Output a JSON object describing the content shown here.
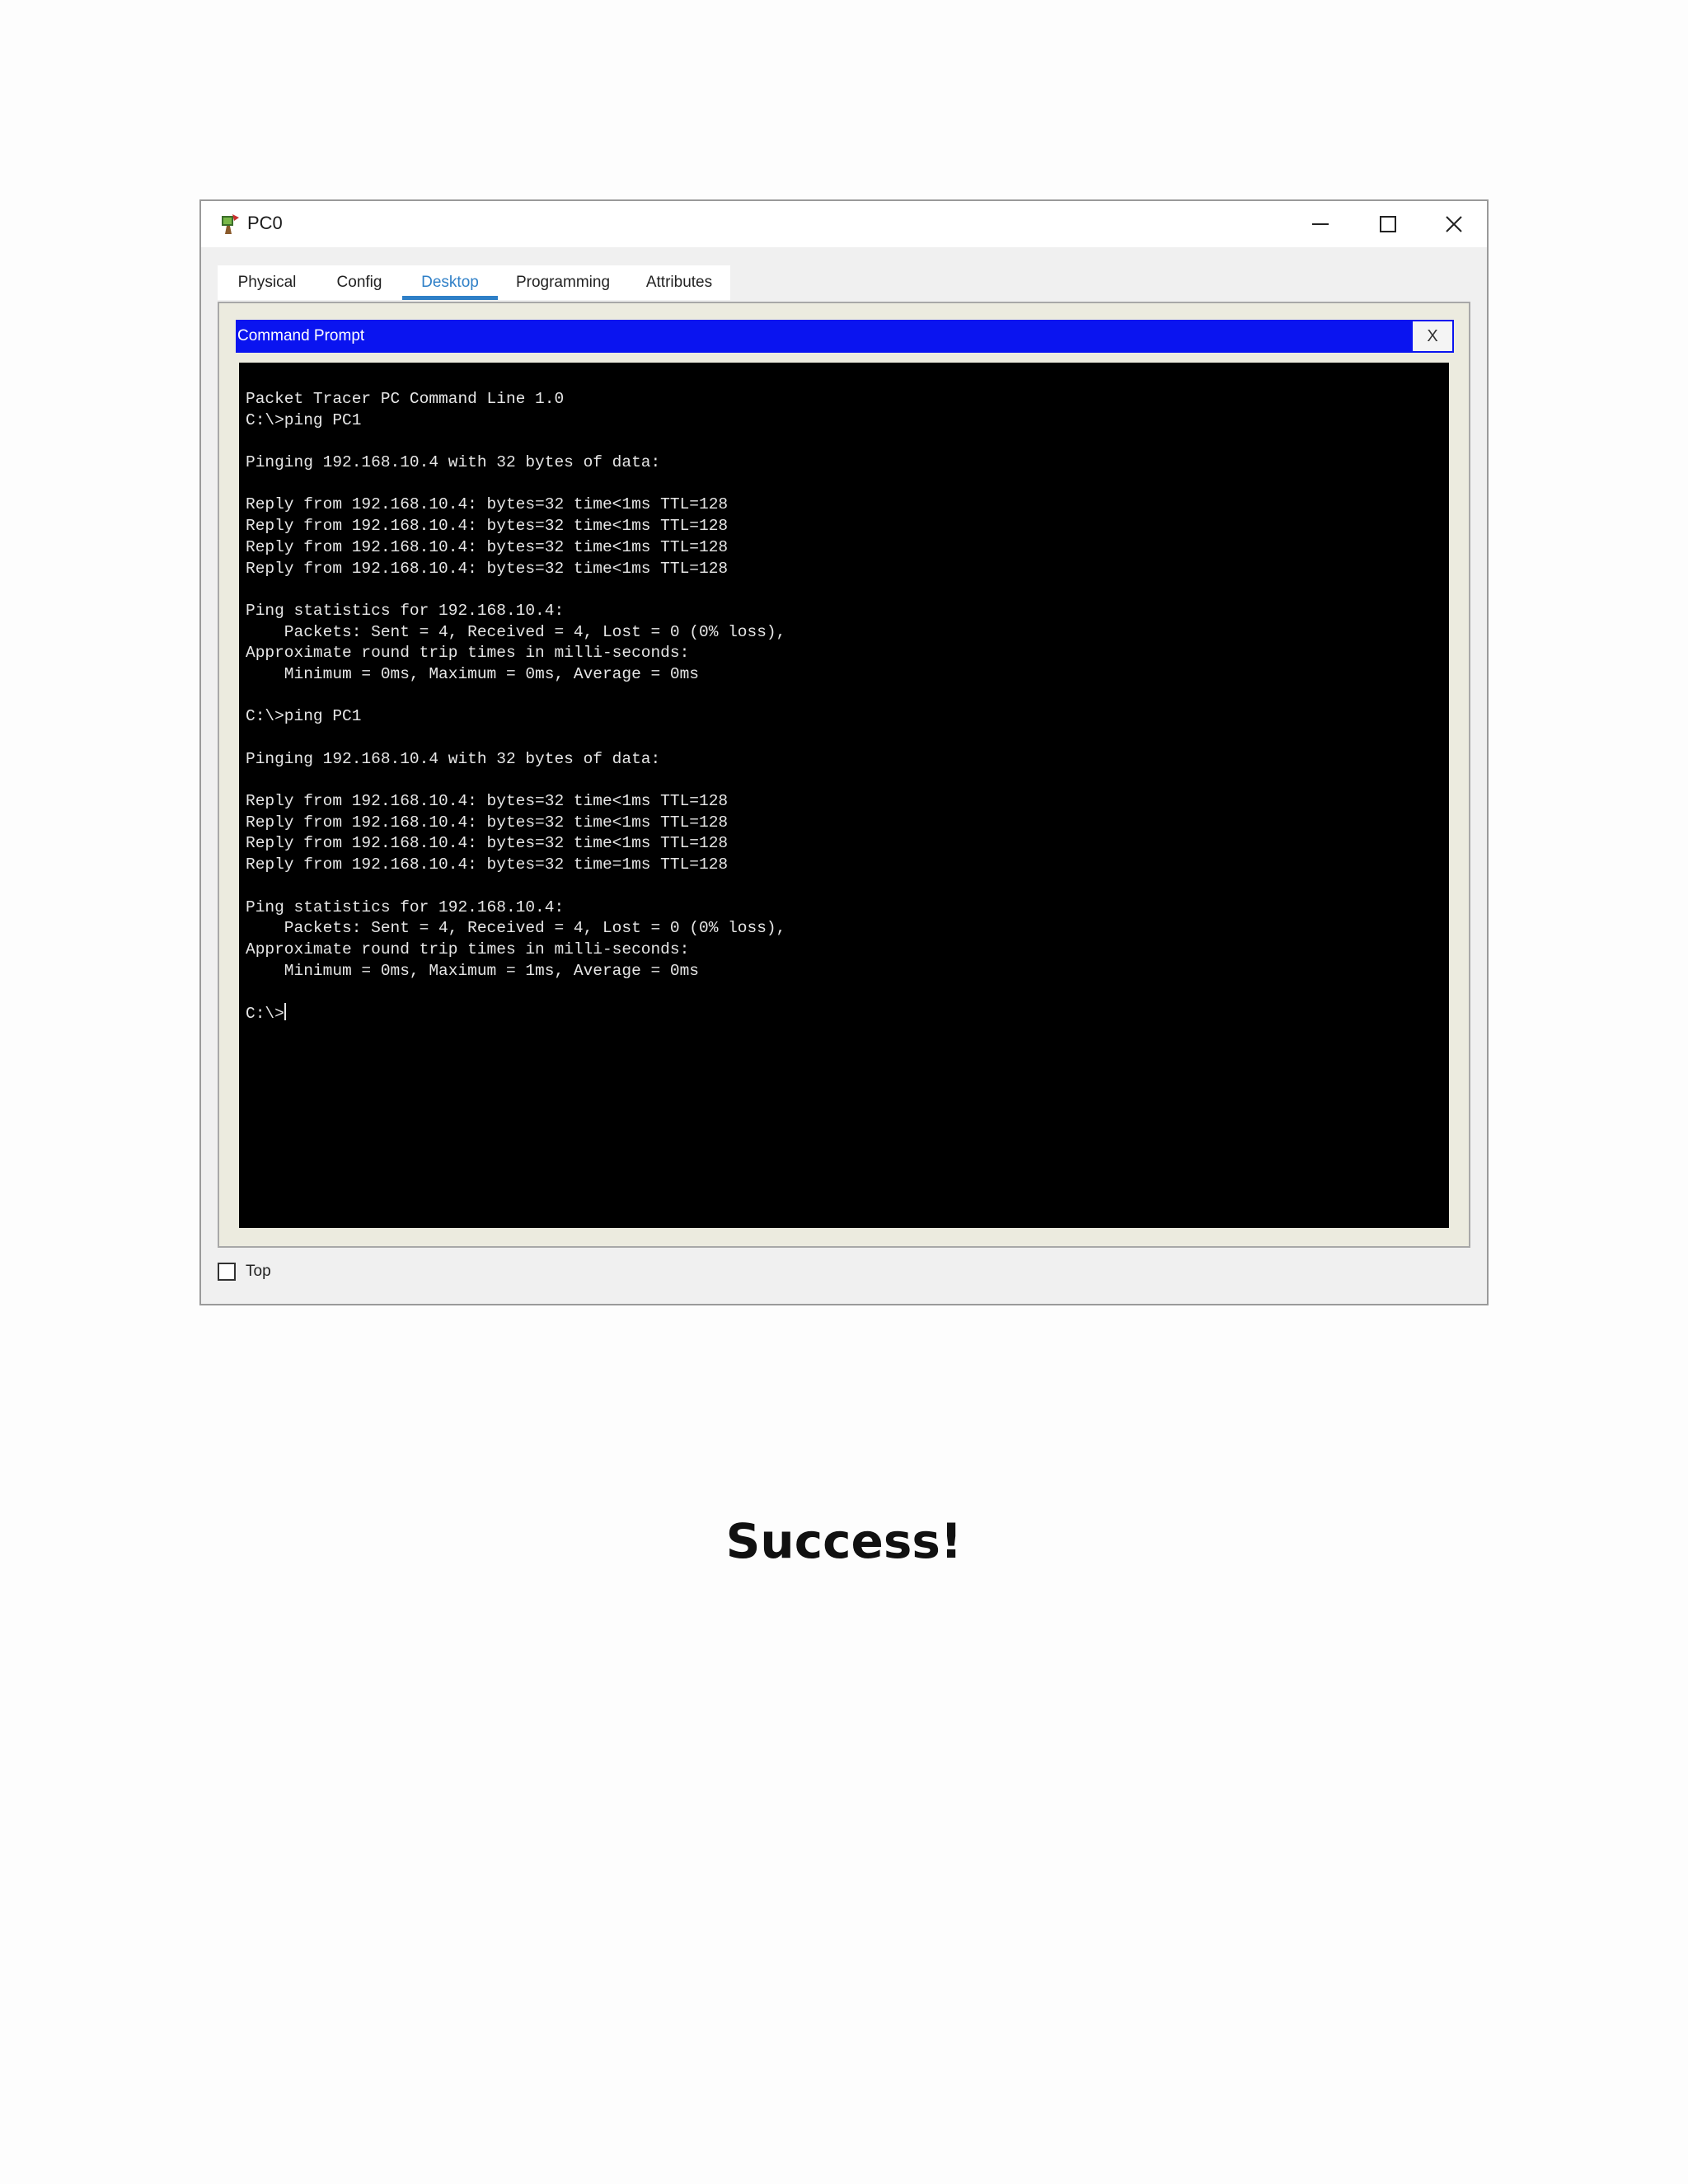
{
  "window": {
    "title": "PC0",
    "icon": "packet-tracer-pc-icon",
    "controls": [
      "minimize-icon",
      "maximize-icon",
      "close-icon"
    ]
  },
  "tabs": [
    {
      "label": "Physical",
      "active": false
    },
    {
      "label": "Config",
      "active": false
    },
    {
      "label": "Desktop",
      "active": true
    },
    {
      "label": "Programming",
      "active": false
    },
    {
      "label": "Attributes",
      "active": false
    }
  ],
  "command_prompt": {
    "title": "Command Prompt",
    "close_label": "X",
    "lines": [
      "Packet Tracer PC Command Line 1.0",
      "C:\\>ping PC1",
      "",
      "Pinging 192.168.10.4 with 32 bytes of data:",
      "",
      "Reply from 192.168.10.4: bytes=32 time<1ms TTL=128",
      "Reply from 192.168.10.4: bytes=32 time<1ms TTL=128",
      "Reply from 192.168.10.4: bytes=32 time<1ms TTL=128",
      "Reply from 192.168.10.4: bytes=32 time<1ms TTL=128",
      "",
      "Ping statistics for 192.168.10.4:",
      "    Packets: Sent = 4, Received = 4, Lost = 0 (0% loss),",
      "Approximate round trip times in milli-seconds:",
      "    Minimum = 0ms, Maximum = 0ms, Average = 0ms",
      "",
      "C:\\>ping PC1",
      "",
      "Pinging 192.168.10.4 with 32 bytes of data:",
      "",
      "Reply from 192.168.10.4: bytes=32 time<1ms TTL=128",
      "Reply from 192.168.10.4: bytes=32 time<1ms TTL=128",
      "Reply from 192.168.10.4: bytes=32 time<1ms TTL=128",
      "Reply from 192.168.10.4: bytes=32 time=1ms TTL=128",
      "",
      "Ping statistics for 192.168.10.4:",
      "    Packets: Sent = 4, Received = 4, Lost = 0 (0% loss),",
      "Approximate round trip times in milli-seconds:",
      "    Minimum = 0ms, Maximum = 1ms, Average = 0ms",
      ""
    ],
    "prompt": "C:\\>"
  },
  "footer": {
    "top_checkbox_label": "Top",
    "top_checked": false
  },
  "caption": "Success!",
  "colors": {
    "titlebar_blue": "#0a14f0",
    "active_tab": "#2e7fc7",
    "terminal_bg": "#000000",
    "terminal_text": "#e6e6e6"
  }
}
